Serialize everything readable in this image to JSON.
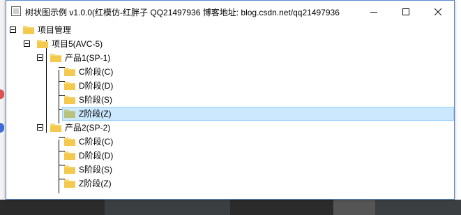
{
  "window": {
    "title": "树状图示例 v1.0.0(红模仿-红胖子 QQ21497936 博客地址: blog.csdn.net/qq21497936"
  },
  "controls": {
    "minimize_icon": "minimize-icon",
    "maximize_icon": "maximize-icon",
    "close_icon": "close-icon"
  },
  "colors": {
    "selection_bg": "#cce8ff",
    "selection_border": "#99d1ff",
    "folder": "#f8d775",
    "folder_selected": "#b7c27c"
  },
  "tree": {
    "root": {
      "label": "项目管理"
    },
    "project": {
      "label": "项目5(AVC-5)"
    },
    "products": [
      {
        "label": "产品1(SP-1)",
        "stages": [
          {
            "label": "C阶段(C)"
          },
          {
            "label": "D阶段(D)"
          },
          {
            "label": "S阶段(S)"
          },
          {
            "label": "Z阶段(Z)",
            "selected": true
          }
        ]
      },
      {
        "label": "产品2(SP-2)",
        "stages": [
          {
            "label": "C阶段(C)"
          },
          {
            "label": "D阶段(D)"
          },
          {
            "label": "S阶段(S)"
          },
          {
            "label": "Z阶段(Z)"
          }
        ]
      }
    ]
  }
}
